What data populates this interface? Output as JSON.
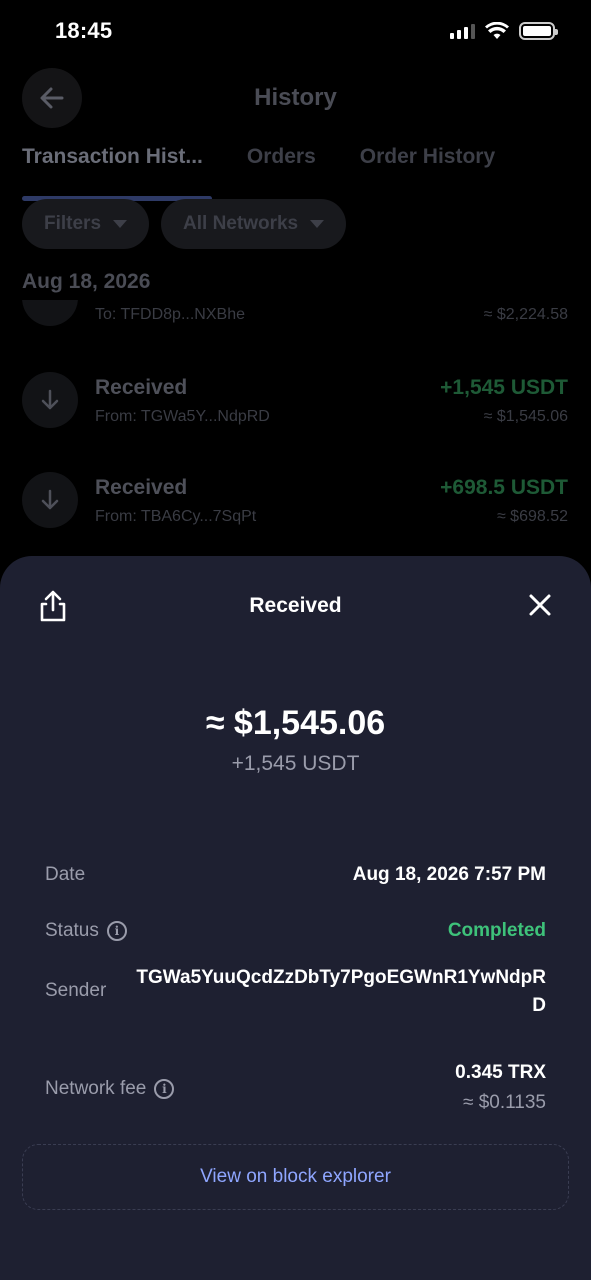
{
  "status_bar": {
    "time": "18:45"
  },
  "header": {
    "title": "History"
  },
  "tabs": [
    {
      "label": "Transaction Hist..."
    },
    {
      "label": "Orders"
    },
    {
      "label": "Order History"
    }
  ],
  "filters": [
    {
      "label": "Filters"
    },
    {
      "label": "All Networks"
    }
  ],
  "list": {
    "date_heading": "Aug 18, 2026",
    "items": [
      {
        "title": "",
        "subtitle": "To: TFDD8p...NXBhe",
        "amount": "",
        "fiat": "≈ $2,224.58"
      },
      {
        "title": "Received",
        "subtitle": "From: TGWa5Y...NdpRD",
        "amount": "+1,545 USDT",
        "fiat": "≈ $1,545.06"
      },
      {
        "title": "Received",
        "subtitle": "From: TBA6Cy...7SqPt",
        "amount": "+698.5 USDT",
        "fiat": "≈ $698.52"
      }
    ]
  },
  "sheet": {
    "title": "Received",
    "fiat_amount": "≈ $1,545.06",
    "crypto_amount": "+1,545 USDT",
    "details": {
      "date_label": "Date",
      "date_value": "Aug 18, 2026 7:57 PM",
      "status_label": "Status",
      "status_value": "Completed",
      "sender_label": "Sender",
      "sender_value": "TGWa5YuuQcdZzDbTy7PgoEGWnR1YwNdpRD",
      "fee_label": "Network fee",
      "fee_value": "0.345 TRX",
      "fee_fiat": "≈ $0.1135"
    },
    "explorer_label": "View on block explorer"
  },
  "colors": {
    "sheet_bg": "#1e2031",
    "completed": "#3ec27a",
    "link": "#8fa6ff"
  }
}
